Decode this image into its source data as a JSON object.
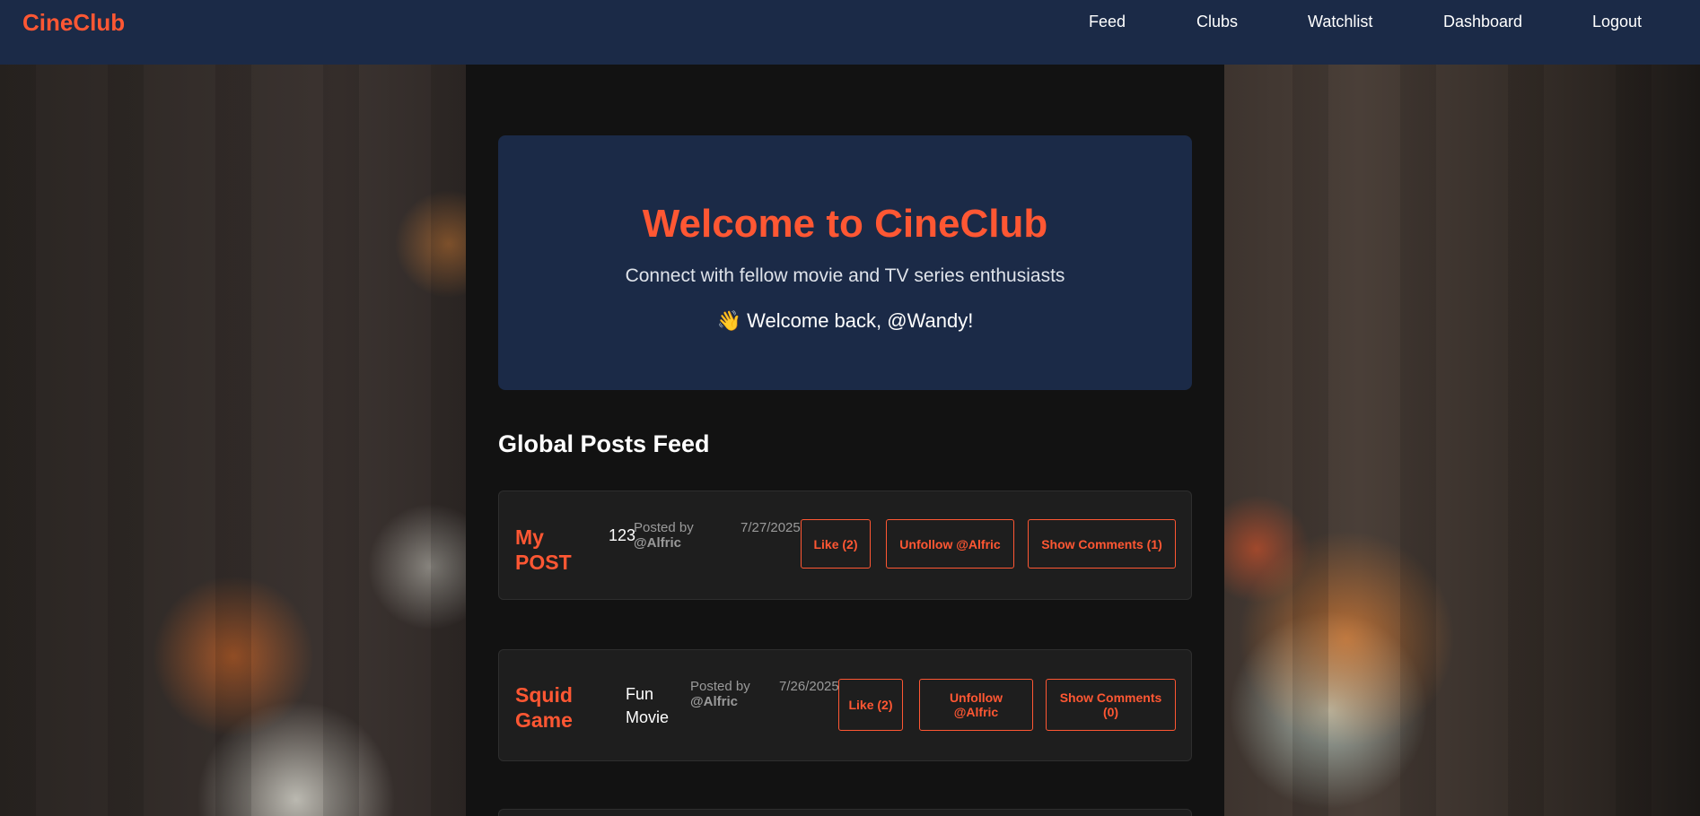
{
  "nav": {
    "brand": "CineClub",
    "links": [
      "Feed",
      "Clubs",
      "Watchlist",
      "Dashboard",
      "Logout"
    ]
  },
  "hero": {
    "title": "Welcome to CineClub",
    "subtitle": "Connect with fellow movie and TV series enthusiasts",
    "welcome": "👋 Welcome back, @Wandy!"
  },
  "feed": {
    "heading": "Global Posts Feed",
    "posts": [
      {
        "title": "My POST",
        "content": "123",
        "posted_by_label": "Posted by",
        "author": "@Alfric",
        "date": "7/27/2025",
        "like_label": "Like (2)",
        "follow_label": "Unfollow @Alfric",
        "comments_label": "Show Comments (1)"
      },
      {
        "title": "Squid Game",
        "content": "Fun Movie",
        "posted_by_label": "Posted by",
        "author": "@Alfric",
        "date": "7/26/2025",
        "like_label": "Like (2)",
        "follow_label": "Unfollow @Alfric",
        "comments_label": "Show Comments (0)"
      }
    ]
  },
  "colors": {
    "accent": "#ff5733",
    "navbar": "#1b2a47",
    "panel": "#121212",
    "card": "#1e1e1e"
  }
}
